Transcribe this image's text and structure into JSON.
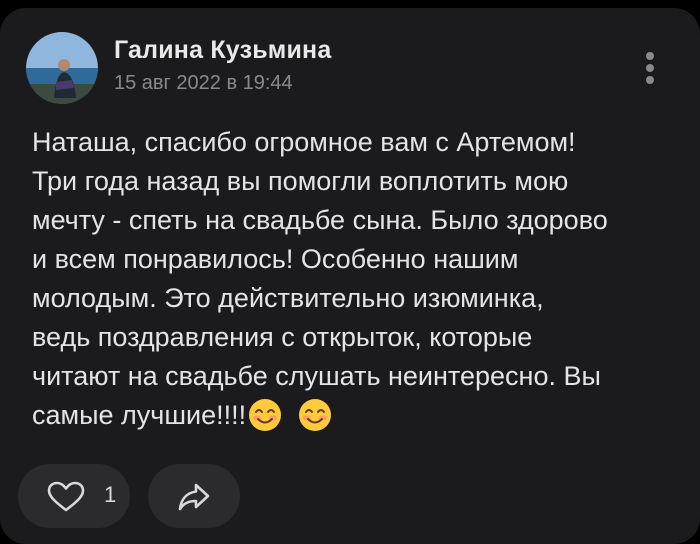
{
  "post": {
    "author": "Галина Кузьмина",
    "date": "15 авг 2022 в 19:44",
    "lines": [
      "Наташа, спасибо огромное вам с Артемом!",
      "Три года назад вы помогли воплотить мою",
      "мечту - спеть на свадьбе сына. Было здорово",
      "и всем понравилось! Особенно нашим",
      "молодым. Это действительно изюминка,",
      "ведь поздравления с открыток, которые",
      "читают на свадьбе слушать неинтересно. Вы",
      "самые лучшие!!!!"
    ],
    "emojis": [
      "smiling-face-emoji",
      "smiling-face-emoji"
    ]
  },
  "actions": {
    "like_icon": "heart-icon",
    "like_count": "1",
    "share_icon": "share-arrow-icon",
    "more_icon": "more-vertical-icon"
  },
  "colors": {
    "background": "#000000",
    "card": "#1b1b1d",
    "pill": "#2b2b2e",
    "text": "#e4e4e6",
    "secondary_text": "#8a8a8e"
  }
}
